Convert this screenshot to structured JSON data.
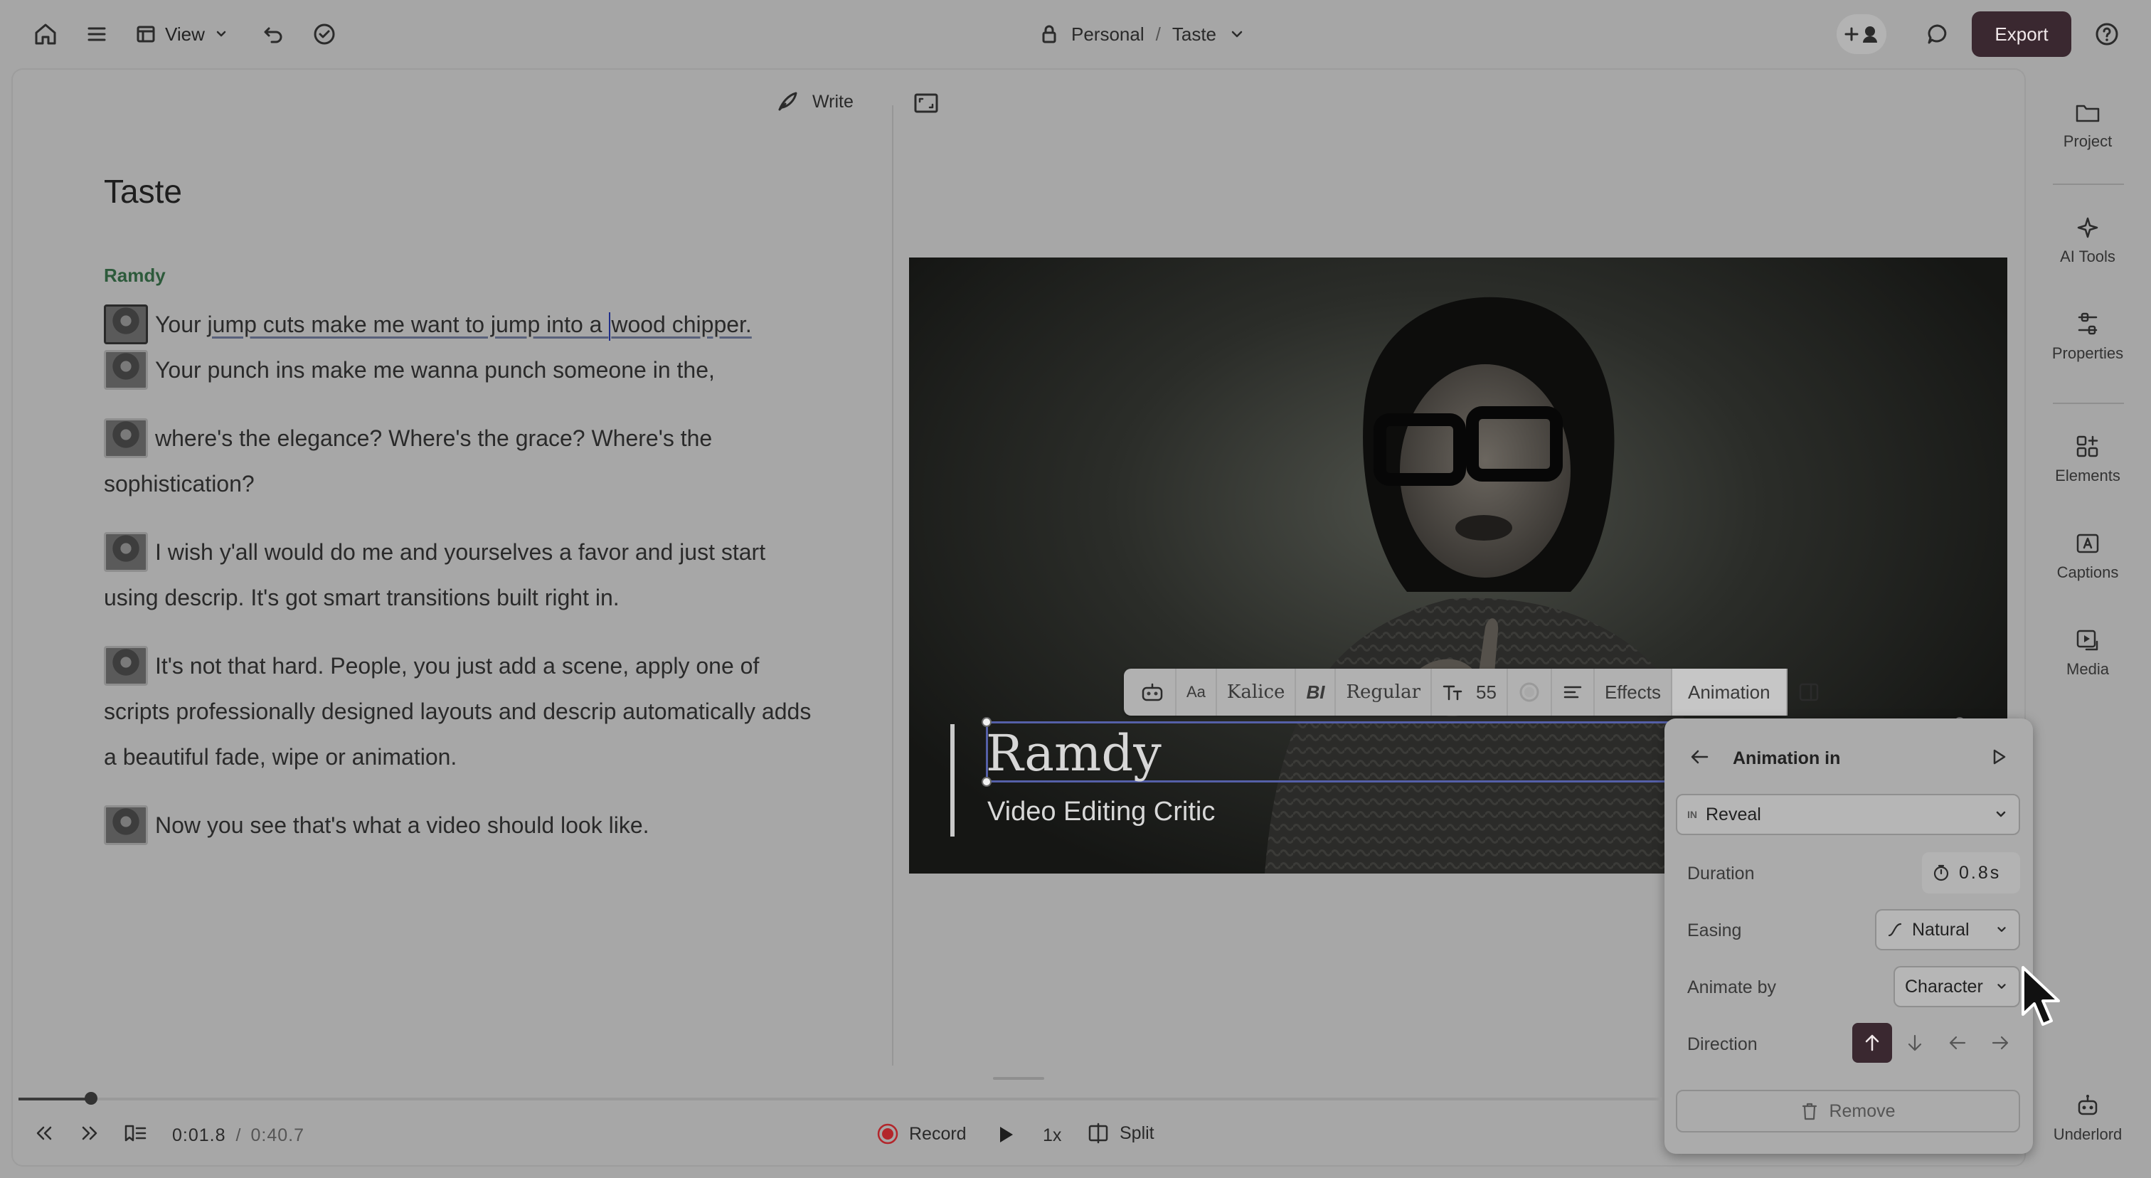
{
  "topbar": {
    "view_label": "View",
    "breadcrumb": {
      "workspace": "Personal",
      "separator": "/",
      "project": "Taste"
    },
    "export_label": "Export"
  },
  "editor": {
    "write_label": "Write",
    "doc_title": "Taste",
    "speaker": "Ramdy",
    "paragraphs": [
      {
        "pre": "Your ",
        "hl1": "jump cuts make me want to jump into a ",
        "hl2": "wood chipper."
      },
      {
        "text": "Your punch ins make me wanna punch someone in the,"
      },
      {
        "text": "where's the elegance? Where's the grace? Where's the sophistication?"
      },
      {
        "text": "I wish y'all would do me and yourselves a favor and just start using descrip. It's got smart transitions built right in."
      },
      {
        "text": "It's not that hard. People, you just add a scene, apply one of scripts professionally designed layouts and descrip automatically adds a beautiful fade, wipe or animation."
      },
      {
        "text": "Now you see that's what a video should look like."
      }
    ]
  },
  "video": {
    "title_overlay": "Ramdy",
    "subtitle_overlay": "Video Editing Critic"
  },
  "toolbar": {
    "case_label": "Aa",
    "font_label": "Kalice",
    "style_label": "BI",
    "weight_label": "Regular",
    "size_value": "55",
    "effects_label": "Effects",
    "animation_label": "Animation"
  },
  "sidebar": {
    "items": [
      {
        "label": "Project"
      },
      {
        "label": "AI Tools"
      },
      {
        "label": "Properties"
      },
      {
        "label": "Elements"
      },
      {
        "label": "Captions"
      },
      {
        "label": "Media"
      },
      {
        "label": "Underlord"
      }
    ]
  },
  "animation_panel": {
    "title": "Animation in",
    "type_badge": "IN",
    "type_value": "Reveal",
    "duration_label": "Duration",
    "duration_value": "0.8s",
    "easing_label": "Easing",
    "easing_value": "Natural",
    "animate_by_label": "Animate by",
    "animate_by_value": "Character",
    "direction_label": "Direction",
    "direction_selected": "up",
    "remove_label": "Remove"
  },
  "transport": {
    "current_time": "0:01.8",
    "time_separator": "/",
    "total_time": "0:40.7",
    "record_label": "Record",
    "speed_label": "1x",
    "split_label": "Split",
    "progress_fraction": 0.044
  }
}
